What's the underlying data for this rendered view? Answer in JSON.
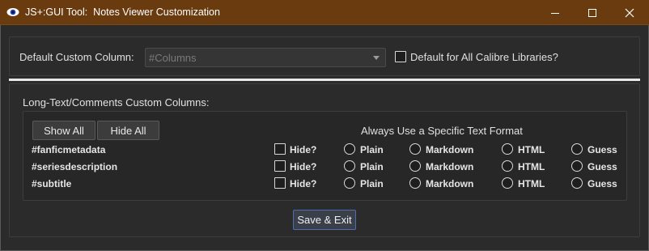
{
  "window": {
    "title": "JS+:GUI Tool:  Notes Viewer Customization",
    "icon": "eye-icon"
  },
  "top": {
    "default_label": "Default Custom Column:",
    "combo_value": "#Columns",
    "all_libraries_label": "Default for All Calibre Libraries?",
    "all_libraries_checked": false
  },
  "columns_section": {
    "label": "Long-Text/Comments Custom Columns:",
    "show_all": "Show All",
    "hide_all": "Hide All",
    "format_header": "Always Use a Specific Text Format",
    "rows": [
      {
        "name": "#fanficmetadata",
        "hide": "Hide?",
        "plain": "Plain",
        "markdown": "Markdown",
        "html": "HTML",
        "guess": "Guess"
      },
      {
        "name": "#seriesdescription",
        "hide": "Hide?",
        "plain": "Plain",
        "markdown": "Markdown",
        "html": "HTML",
        "guess": "Guess"
      },
      {
        "name": "#subtitle",
        "hide": "Hide?",
        "plain": "Plain",
        "markdown": "Markdown",
        "html": "HTML",
        "guess": "Guess"
      }
    ]
  },
  "save_exit": "Save & Exit",
  "colors": {
    "titlebar": "#6b3b10",
    "background": "#2b2b2b",
    "accent_border": "#4e6fae"
  }
}
